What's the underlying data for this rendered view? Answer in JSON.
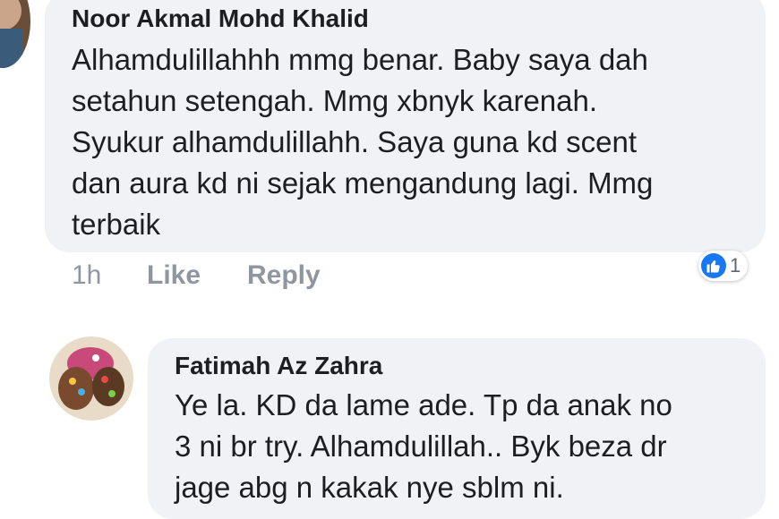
{
  "comments": [
    {
      "author": "Noor Akmal Mohd Khalid",
      "text": "Alhamdulillahhh mmg benar. Baby saya dah\nsetahun setengah. Mmg xbnyk karenah.\nSyukur alhamdulillahh. Saya guna kd scent\ndan aura kd ni sejak mengandung lagi. Mmg\nterbaik",
      "time": "1h",
      "like_label": "Like",
      "reply_label": "Reply",
      "reaction_count": "1",
      "reaction_icon": "thumbs-up-icon",
      "reaction_color": "#1877f2"
    },
    {
      "author": "Fatimah Az Zahra",
      "text": "Ye la. KD da lame ade. Tp da anak no\n3 ni br try. Alhamdulillah.. Byk beza dr\njage abg n kakak nye sblm ni."
    }
  ]
}
